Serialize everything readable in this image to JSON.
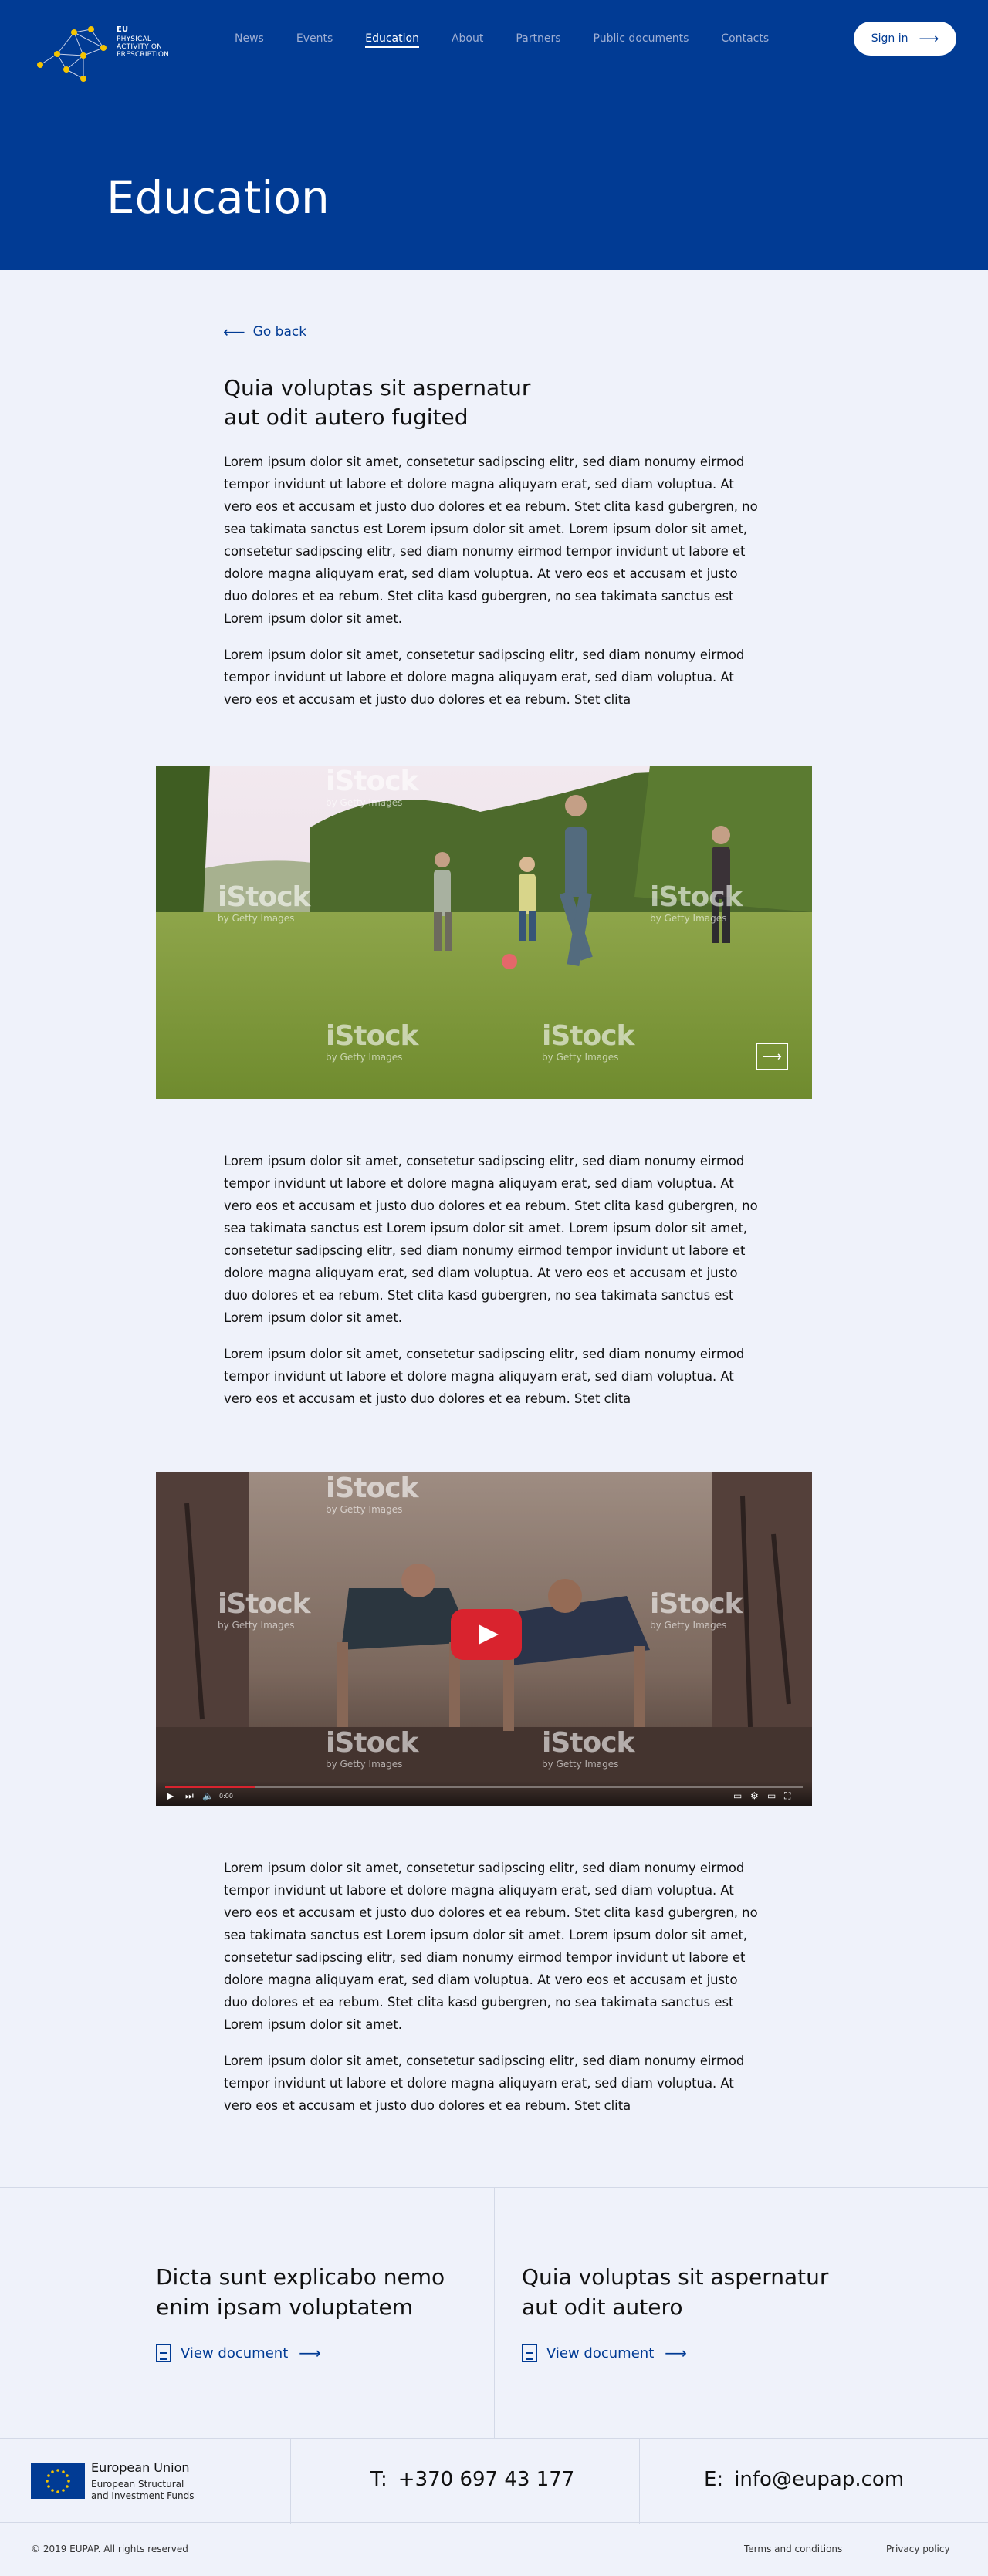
{
  "header": {
    "logo_lines": [
      "EU",
      "PHYSICAL",
      "ACTIVITY ON",
      "PRESCRIPTION"
    ],
    "nav": [
      "News",
      "Events",
      "Education",
      "About",
      "Partners",
      "Public documents",
      "Contacts"
    ],
    "active_nav": "Education",
    "signin_label": "Sign in",
    "page_title": "Education",
    "colors": {
      "brand": "#013b94",
      "accent": "#f5c400",
      "background": "#eff2fa"
    }
  },
  "article": {
    "back_label": "Go back",
    "title": "Quia voluptas sit aspernatur aut odit autero fugited",
    "p1": "Lorem ipsum dolor sit amet, consetetur sadipscing elitr, sed diam nonumy eirmod tempor invidunt ut labore et dolore magna aliquyam erat, sed diam voluptua. At vero eos et accusam et justo duo dolores et ea rebum. Stet clita kasd gubergren, no sea takimata sanctus est Lorem ipsum dolor sit amet. Lorem ipsum dolor sit amet, consetetur sadipscing elitr, sed diam nonumy eirmod tempor invidunt ut labore et dolore magna aliquyam erat, sed diam voluptua. At vero eos et accusam et justo duo dolores et ea rebum. Stet clita kasd gubergren, no sea takimata sanctus est Lorem ipsum dolor sit amet.",
    "p2": "Lorem ipsum dolor sit amet, consetetur sadipscing elitr, sed diam nonumy eirmod tempor invidunt ut labore et dolore magna aliquyam erat, sed diam voluptua. At vero eos et accusam et justo duo dolores et ea rebum. Stet clita",
    "watermark": "iStock",
    "watermark_sub": "by Getty Images",
    "video_time": "0:00"
  },
  "documents": [
    {
      "title": "Dicta sunt explicabo nemo enim ipsam voluptatem",
      "link": "View document"
    },
    {
      "title": "Quia voluptas sit aspernatur aut odit autero",
      "link": "View document"
    }
  ],
  "contact": {
    "eu_name": "European Union",
    "eu_fund_1": "European Structural",
    "eu_fund_2": "and Investment Funds",
    "phone_label": "T:",
    "phone": "+370 697 43 177",
    "email_label": "E:",
    "email": "info@eupap.com"
  },
  "footer": {
    "copyright": "© 2019 EUPAP. All rights reserved",
    "terms": "Terms and conditions",
    "privacy": "Privacy policy"
  }
}
